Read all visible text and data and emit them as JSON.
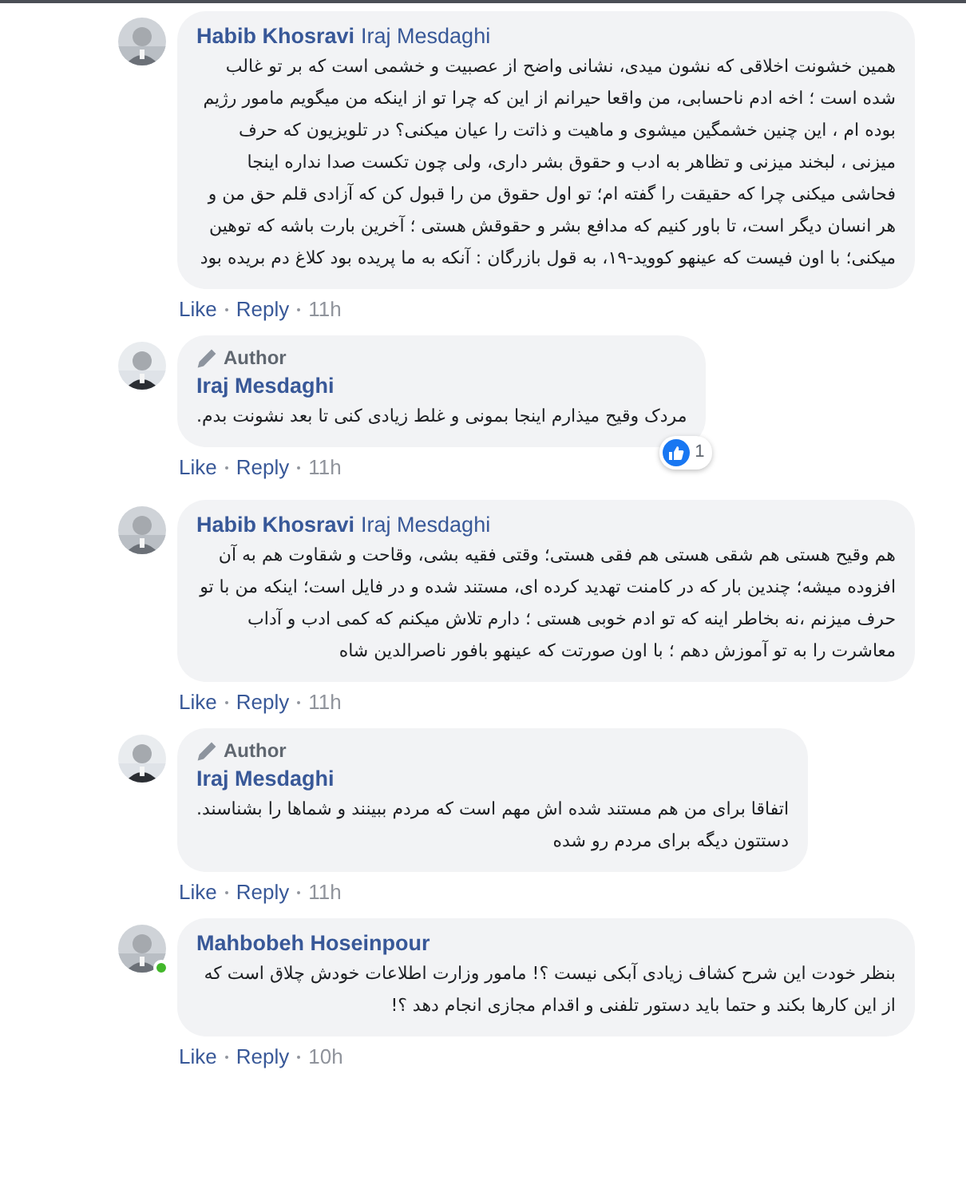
{
  "comments": [
    {
      "author": "Habib Khosravi",
      "mention": "Iraj Mesdaghi",
      "text": "همین خشونت اخلاقی که نشون میدی، نشانی واضح از عصبیت و خشمی است که بر تو غالب شده است ؛ اخه ادم ناحسابی، من واقعا حیرانم از این که چرا تو از اینکه من میگویم مامور رژیم بوده ام ، این چنین خشمگین میشوی و ماهیت و ذاتت را عیان میکنی؟ در تلویزیون که حرف میزنی ، لبخند میزنی و تظاهر به ادب و حقوق بشر داری، ولی چون تکست صدا نداره اینجا فحاشی میکنی چرا که حقیقت را گفته ام؛ تو اول حقوق من را قبول کن که آزادی قلم حق من و هر انسان دیگر است، تا باور کنیم که مدافع بشر و حقوقش هستی ؛ آخرین بارت باشه که توهین میکنی؛ با اون فیست که عینهو کووید-۱۹، به قول بازرگان : آنکه به ما پریده بود کلاغ دم بریده بود",
      "like": "Like",
      "reply": "Reply",
      "time": "11h",
      "online": false
    },
    {
      "author_badge": "Author",
      "author": "Iraj Mesdaghi",
      "text": "مردک وقیح میذارم اینجا بمونی و غلط زیادی کنی تا بعد نشونت بدم.",
      "reaction_count": "1",
      "like": "Like",
      "reply": "Reply",
      "time": "11h",
      "online": false
    },
    {
      "author": "Habib Khosravi",
      "mention": "Iraj Mesdaghi",
      "text": "هم وقیح هستی هم شقی هستی هم فقی هستی؛ وقتی فقیه بشی، وقاحت و شقاوت هم به آن افزوده میشه؛ چندین بار که در کامنت تهدید کرده ای، مستند شده و در فایل است؛ اینکه من با تو حرف میزنم ،نه بخاطر اینه که تو ادم خوبی هستی ؛ دارم تلاش میکنم که کمی ادب و آداب معاشرت را به تو آموزش دهم ؛ با اون صورتت که عینهو بافور ناصرالدین شاه",
      "like": "Like",
      "reply": "Reply",
      "time": "11h",
      "online": false
    },
    {
      "author_badge": "Author",
      "author": "Iraj Mesdaghi",
      "text": "اتفاقا برای من هم مستند شده اش مهم است که مردم ببینند و شماها را بشناسند.\nدستتون دیگه برای مردم رو شده",
      "like": "Like",
      "reply": "Reply",
      "time": "11h",
      "online": false
    },
    {
      "author": "Mahbobeh Hoseinpour",
      "text": "بنظر خودت این شرح کشاف زیادی آبکی نیست ؟! مامور وزارت اطلاعات خودش چلاق است که از این کارها بکند و حتما باید دستور تلفنی و اقدام مجازی انجام دهد ؟!",
      "like": "Like",
      "reply": "Reply",
      "time": "10h",
      "online": true
    }
  ]
}
